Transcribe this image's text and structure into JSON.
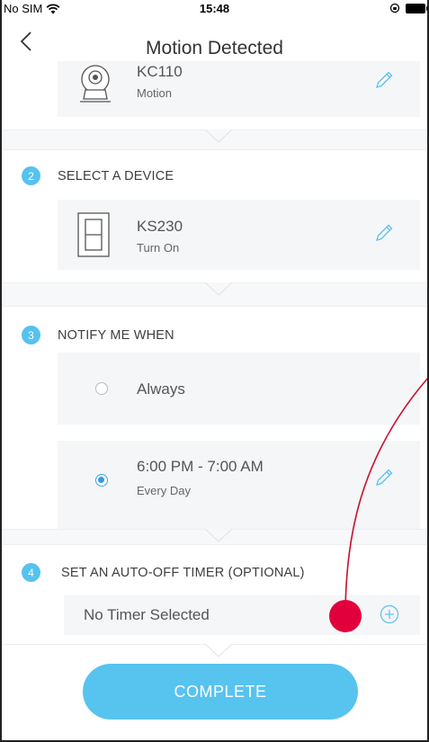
{
  "status_bar": {
    "carrier": "No SIM",
    "time": "15:48"
  },
  "nav": {
    "title": "Motion Detected"
  },
  "trigger_device": {
    "name": "KC110",
    "action": "Motion"
  },
  "section_2": {
    "number": "2",
    "label": "SELECT A DEVICE",
    "device_name": "KS230",
    "device_action": "Turn On"
  },
  "section_3": {
    "number": "3",
    "label": "NOTIFY ME WHEN",
    "option_always": "Always",
    "option_schedule": "6:00 PM - 7:00 AM",
    "option_schedule_days": "Every Day",
    "selected": "schedule"
  },
  "section_4": {
    "number": "4",
    "label": "SET AN AUTO-OFF TIMER (OPTIONAL)",
    "timer_value": "No Timer Selected"
  },
  "complete_label": "COMPLETE",
  "colors": {
    "accent": "#57c3ef",
    "touch_indicator": "#e2003c",
    "annotation_line": "#c8102e"
  },
  "icons": [
    "wifi-icon",
    "lock-rotation-icon",
    "battery-icon",
    "back-chevron-icon",
    "camera-icon",
    "pencil-icon",
    "switch-icon",
    "plus-circle-icon"
  ]
}
